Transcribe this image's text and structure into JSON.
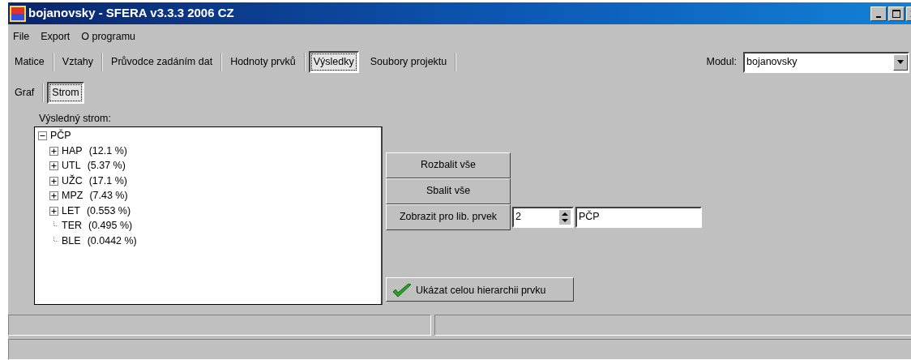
{
  "window": {
    "title": "bojanovsky  - SFERA v3.3.3 2006 CZ"
  },
  "menu": [
    "File",
    "Export",
    "O programu"
  ],
  "tabs": [
    {
      "label": "Matice",
      "selected": false
    },
    {
      "label": "Vztahy",
      "selected": false
    },
    {
      "label": "Průvodce zadáním dat",
      "selected": false
    },
    {
      "label": "Hodnoty prvků",
      "selected": false
    },
    {
      "label": "Výsledky",
      "selected": true
    },
    {
      "label": "Soubory projektu",
      "selected": false
    }
  ],
  "module": {
    "label": "Modul:",
    "value": "bojanovsky"
  },
  "subtabs": [
    {
      "label": "Graf",
      "selected": false
    },
    {
      "label": "Strom",
      "selected": true
    }
  ],
  "tree": {
    "label": "Výsledný strom:",
    "root": {
      "name": "PČP",
      "expanded": true,
      "children": [
        {
          "name": "HAP",
          "share": "(12.1 %)",
          "expandable": true
        },
        {
          "name": "UTL",
          "share": "(5.37 %)",
          "expandable": true
        },
        {
          "name": "UŽC",
          "share": "(17.1 %)",
          "expandable": true
        },
        {
          "name": "MPZ",
          "share": "(7.43 %)",
          "expandable": true
        },
        {
          "name": "LET",
          "share": "(0.553 %)",
          "expandable": true
        },
        {
          "name": "TER",
          "share": "(0.495 %)",
          "expandable": false
        },
        {
          "name": "BLE",
          "share": "(0.0442 %)",
          "expandable": false
        }
      ]
    }
  },
  "actions": [
    "Rozbalit vše",
    "Sbalit vše",
    "Zobrazit pro lib. prvek"
  ],
  "level_field": {
    "value": "2"
  },
  "element_field": {
    "value": "PČP"
  },
  "hierarchy_button": {
    "label": "Ukázat celou hierarchii prvku"
  }
}
